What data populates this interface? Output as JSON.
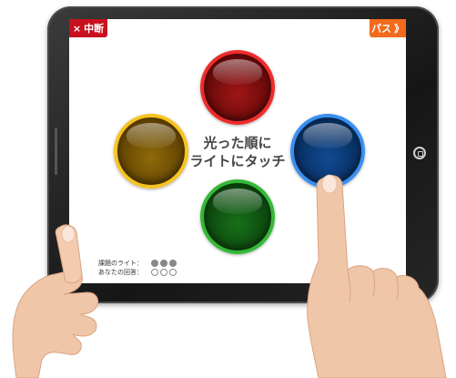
{
  "toolbar": {
    "quit_icon": "×",
    "quit_label": "中断",
    "pass_label": "パス",
    "pass_icon": "》"
  },
  "lights": [
    {
      "name": "red",
      "color": "#ee2c2c"
    },
    {
      "name": "yellow",
      "color": "#f7c31f"
    },
    {
      "name": "blue",
      "color": "#3a8ff0"
    },
    {
      "name": "green",
      "color": "#35b837"
    }
  ],
  "instruction": {
    "line1": "光った順に",
    "line2": "ライトにタッチ"
  },
  "status": {
    "target_label": "課題のライト：",
    "answer_label": "あなたの回答：",
    "target_filled": 3,
    "answer_filled": 0,
    "total": 3
  }
}
